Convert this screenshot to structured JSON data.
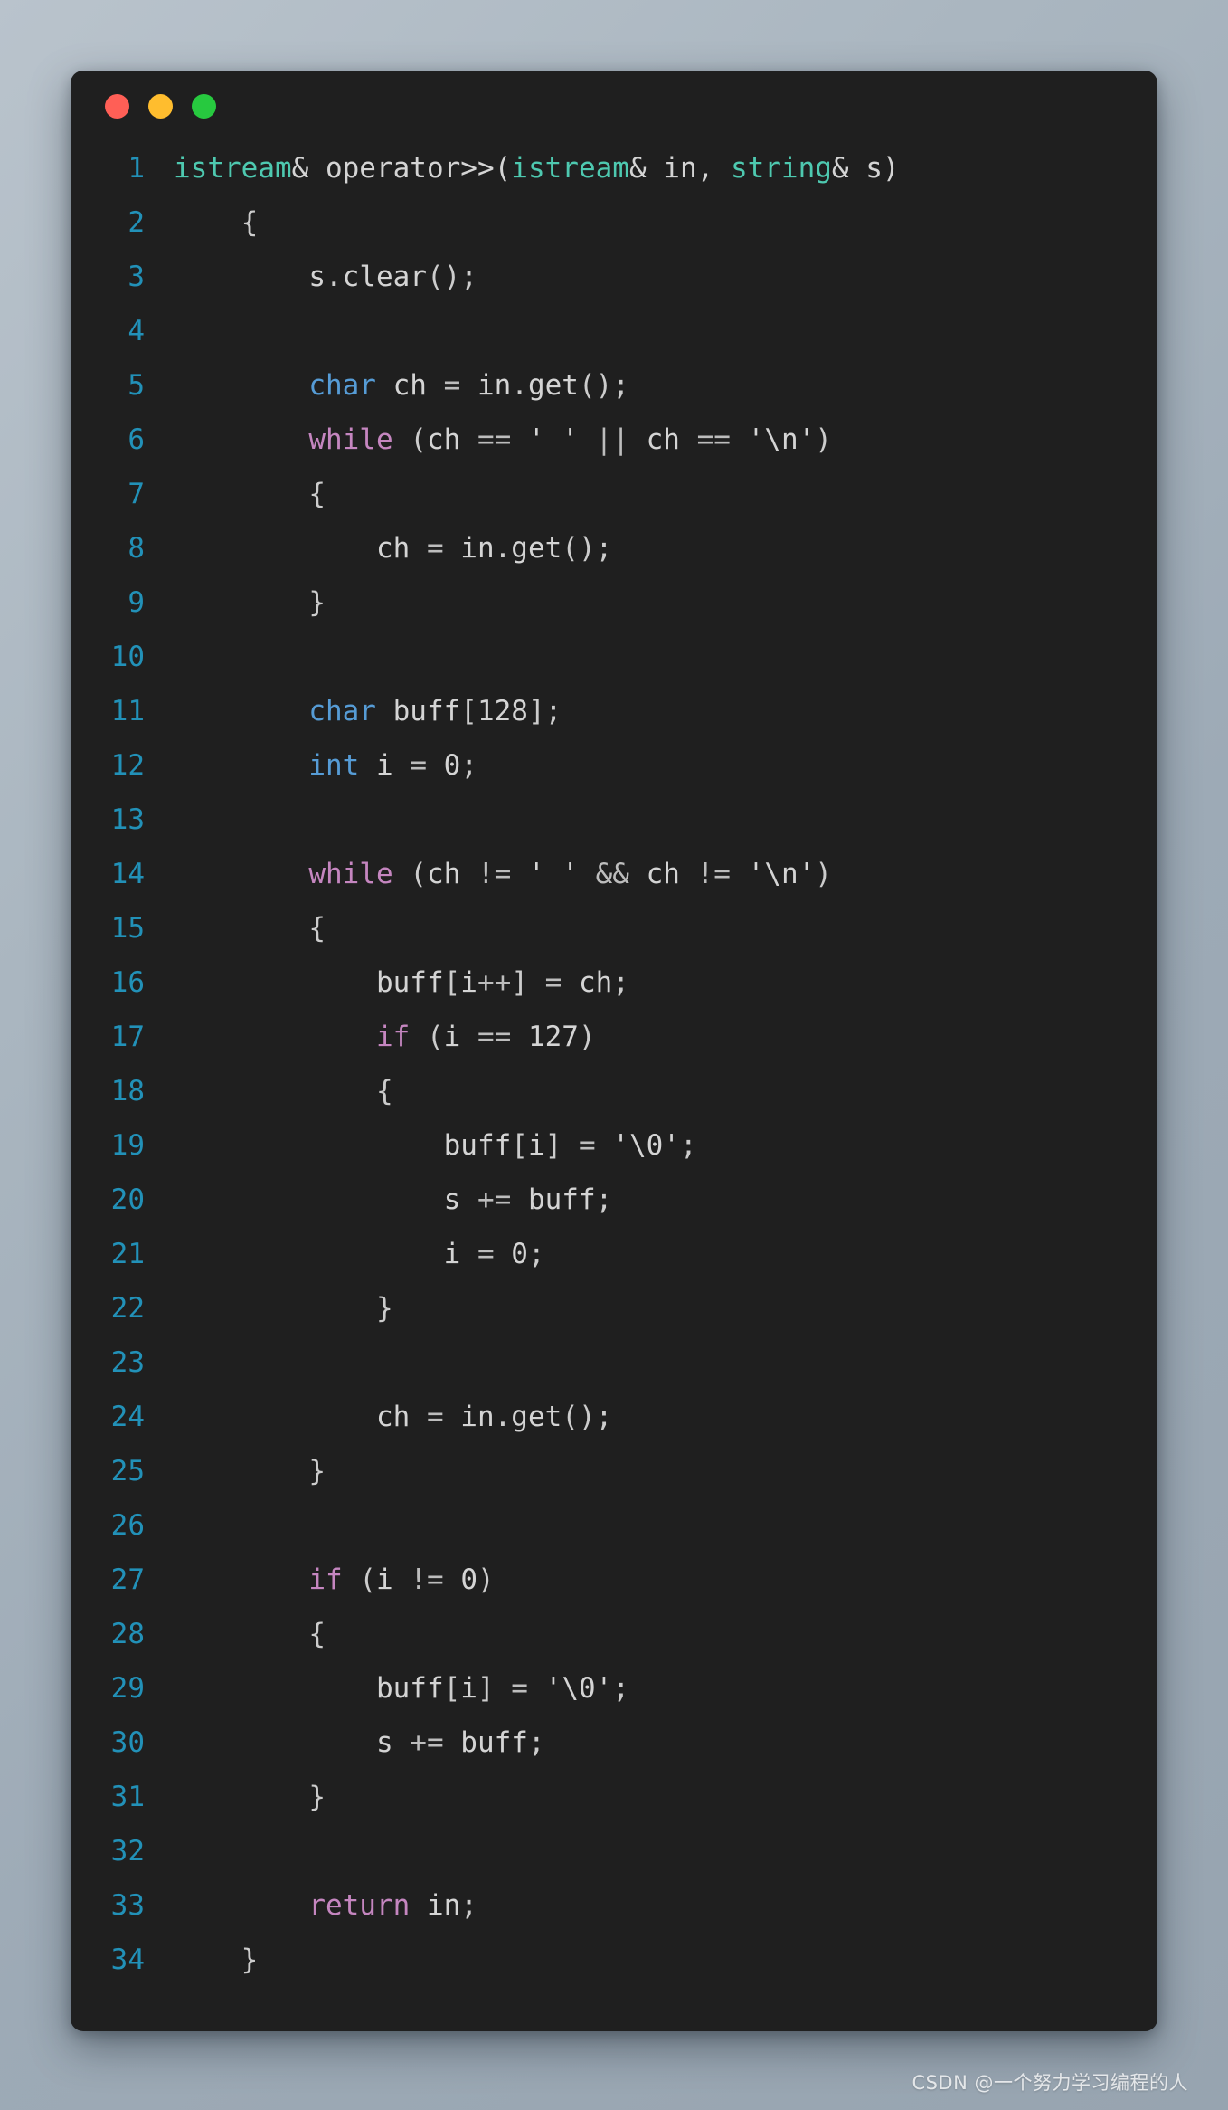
{
  "window": {
    "background_color": "#1f1f1f",
    "page_background_from": "#b9c3cc",
    "page_background_to": "#97a4b0",
    "traffic_lights": [
      {
        "name": "close",
        "color": "#ff5f56"
      },
      {
        "name": "minimize",
        "color": "#ffbd2e"
      },
      {
        "name": "maximize",
        "color": "#27c93f"
      }
    ]
  },
  "theme": {
    "line_number_color": "#2291b8",
    "plain": "#d4d4d4",
    "type": "#4ec9b0",
    "keyword": "#569cd6",
    "control": "#c586c0",
    "function": "#dcdcaa",
    "variable": "#9cdcfe",
    "number": "#b5cea8",
    "string": "#e8b4a0",
    "escape": "#f3c178"
  },
  "watermark": {
    "text": "CSDN @一个努力学习编程的人"
  },
  "code": {
    "language": "cpp",
    "first_line_number": 1,
    "total_lines": 34,
    "lines": [
      {
        "n": "1",
        "text": "istream& operator>>(istream& in, string& s)",
        "tokens": [
          {
            "t": "istream",
            "c": "type"
          },
          {
            "t": "& ",
            "c": "plain"
          },
          {
            "t": "operator",
            "c": "plain"
          },
          {
            "t": ">>",
            "c": "plain"
          },
          {
            "t": "(",
            "c": "plain"
          },
          {
            "t": "istream",
            "c": "type"
          },
          {
            "t": "& ",
            "c": "plain"
          },
          {
            "t": "in",
            "c": "plain"
          },
          {
            "t": ", ",
            "c": "plain"
          },
          {
            "t": "string",
            "c": "type"
          },
          {
            "t": "& ",
            "c": "plain"
          },
          {
            "t": "s",
            "c": "plain"
          },
          {
            "t": ")",
            "c": "plain"
          }
        ]
      },
      {
        "n": "2",
        "text": "    {",
        "tokens": [
          {
            "t": "    ",
            "c": "plain"
          },
          {
            "t": "{",
            "c": "punct"
          }
        ]
      },
      {
        "n": "3",
        "text": "        s.clear();",
        "tokens": [
          {
            "t": "        ",
            "c": "plain"
          },
          {
            "t": "s",
            "c": "plain"
          },
          {
            "t": ".",
            "c": "punct"
          },
          {
            "t": "clear",
            "c": "function"
          },
          {
            "t": "();",
            "c": "punct"
          }
        ]
      },
      {
        "n": "4",
        "text": "",
        "tokens": []
      },
      {
        "n": "5",
        "text": "        char ch = in.get();",
        "tokens": [
          {
            "t": "        ",
            "c": "plain"
          },
          {
            "t": "char",
            "c": "keyword"
          },
          {
            "t": " ",
            "c": "plain"
          },
          {
            "t": "ch",
            "c": "variable"
          },
          {
            "t": " = ",
            "c": "op"
          },
          {
            "t": "in",
            "c": "plain"
          },
          {
            "t": ".",
            "c": "punct"
          },
          {
            "t": "get",
            "c": "function"
          },
          {
            "t": "();",
            "c": "punct"
          }
        ]
      },
      {
        "n": "6",
        "text": "        while (ch == ' ' || ch == '\\n')",
        "tokens": [
          {
            "t": "        ",
            "c": "plain"
          },
          {
            "t": "while",
            "c": "control"
          },
          {
            "t": " ",
            "c": "plain"
          },
          {
            "t": "(",
            "c": "punct"
          },
          {
            "t": "ch",
            "c": "variable"
          },
          {
            "t": " == ",
            "c": "op"
          },
          {
            "t": "' '",
            "c": "string"
          },
          {
            "t": " ",
            "c": "plain"
          },
          {
            "t": "||",
            "c": "op"
          },
          {
            "t": " ",
            "c": "plain"
          },
          {
            "t": "ch",
            "c": "variable"
          },
          {
            "t": " == ",
            "c": "op"
          },
          {
            "t": "'",
            "c": "string"
          },
          {
            "t": "\\n",
            "c": "escape"
          },
          {
            "t": "'",
            "c": "string"
          },
          {
            "t": ")",
            "c": "punct"
          }
        ]
      },
      {
        "n": "7",
        "text": "        {",
        "tokens": [
          {
            "t": "        ",
            "c": "plain"
          },
          {
            "t": "{",
            "c": "punct"
          }
        ]
      },
      {
        "n": "8",
        "text": "            ch = in.get();",
        "tokens": [
          {
            "t": "            ",
            "c": "plain"
          },
          {
            "t": "ch",
            "c": "variable"
          },
          {
            "t": " = ",
            "c": "op"
          },
          {
            "t": "in",
            "c": "plain"
          },
          {
            "t": ".",
            "c": "punct"
          },
          {
            "t": "get",
            "c": "function"
          },
          {
            "t": "();",
            "c": "punct"
          }
        ]
      },
      {
        "n": "9",
        "text": "        }",
        "tokens": [
          {
            "t": "        ",
            "c": "plain"
          },
          {
            "t": "}",
            "c": "punct"
          }
        ]
      },
      {
        "n": "10",
        "text": "",
        "tokens": []
      },
      {
        "n": "11",
        "text": "        char buff[128];",
        "tokens": [
          {
            "t": "        ",
            "c": "plain"
          },
          {
            "t": "char",
            "c": "keyword"
          },
          {
            "t": " ",
            "c": "plain"
          },
          {
            "t": "buff",
            "c": "variable"
          },
          {
            "t": "[",
            "c": "punct"
          },
          {
            "t": "128",
            "c": "number"
          },
          {
            "t": "];",
            "c": "punct"
          }
        ]
      },
      {
        "n": "12",
        "text": "        int i = 0;",
        "tokens": [
          {
            "t": "        ",
            "c": "plain"
          },
          {
            "t": "int",
            "c": "keyword"
          },
          {
            "t": " ",
            "c": "plain"
          },
          {
            "t": "i",
            "c": "variable"
          },
          {
            "t": " = ",
            "c": "op"
          },
          {
            "t": "0",
            "c": "number"
          },
          {
            "t": ";",
            "c": "punct"
          }
        ]
      },
      {
        "n": "13",
        "text": "",
        "tokens": []
      },
      {
        "n": "14",
        "text": "        while (ch != ' ' && ch != '\\n')",
        "tokens": [
          {
            "t": "        ",
            "c": "plain"
          },
          {
            "t": "while",
            "c": "control"
          },
          {
            "t": " ",
            "c": "plain"
          },
          {
            "t": "(",
            "c": "punct"
          },
          {
            "t": "ch",
            "c": "variable"
          },
          {
            "t": " != ",
            "c": "op"
          },
          {
            "t": "' '",
            "c": "string"
          },
          {
            "t": " ",
            "c": "plain"
          },
          {
            "t": "&&",
            "c": "op"
          },
          {
            "t": " ",
            "c": "plain"
          },
          {
            "t": "ch",
            "c": "variable"
          },
          {
            "t": " != ",
            "c": "op"
          },
          {
            "t": "'",
            "c": "string"
          },
          {
            "t": "\\n",
            "c": "escape"
          },
          {
            "t": "'",
            "c": "string"
          },
          {
            "t": ")",
            "c": "punct"
          }
        ]
      },
      {
        "n": "15",
        "text": "        {",
        "tokens": [
          {
            "t": "        ",
            "c": "plain"
          },
          {
            "t": "{",
            "c": "punct"
          }
        ]
      },
      {
        "n": "16",
        "text": "            buff[i++] = ch;",
        "tokens": [
          {
            "t": "            ",
            "c": "plain"
          },
          {
            "t": "buff",
            "c": "variable"
          },
          {
            "t": "[",
            "c": "punct"
          },
          {
            "t": "i",
            "c": "variable"
          },
          {
            "t": "++",
            "c": "op"
          },
          {
            "t": "]",
            "c": "punct"
          },
          {
            "t": " = ",
            "c": "op"
          },
          {
            "t": "ch",
            "c": "variable"
          },
          {
            "t": ";",
            "c": "punct"
          }
        ]
      },
      {
        "n": "17",
        "text": "            if (i == 127)",
        "tokens": [
          {
            "t": "            ",
            "c": "plain"
          },
          {
            "t": "if",
            "c": "control"
          },
          {
            "t": " ",
            "c": "plain"
          },
          {
            "t": "(",
            "c": "punct"
          },
          {
            "t": "i",
            "c": "variable"
          },
          {
            "t": " == ",
            "c": "op"
          },
          {
            "t": "127",
            "c": "number"
          },
          {
            "t": ")",
            "c": "punct"
          }
        ]
      },
      {
        "n": "18",
        "text": "            {",
        "tokens": [
          {
            "t": "            ",
            "c": "plain"
          },
          {
            "t": "{",
            "c": "punct"
          }
        ]
      },
      {
        "n": "19",
        "text": "                buff[i] = '\\0';",
        "tokens": [
          {
            "t": "                ",
            "c": "plain"
          },
          {
            "t": "buff",
            "c": "variable"
          },
          {
            "t": "[",
            "c": "punct"
          },
          {
            "t": "i",
            "c": "variable"
          },
          {
            "t": "]",
            "c": "punct"
          },
          {
            "t": " = ",
            "c": "op"
          },
          {
            "t": "'",
            "c": "string"
          },
          {
            "t": "\\0",
            "c": "escape"
          },
          {
            "t": "'",
            "c": "string"
          },
          {
            "t": ";",
            "c": "punct"
          }
        ]
      },
      {
        "n": "20",
        "text": "                s += buff;",
        "tokens": [
          {
            "t": "                ",
            "c": "plain"
          },
          {
            "t": "s",
            "c": "plain"
          },
          {
            "t": " += ",
            "c": "op"
          },
          {
            "t": "buff",
            "c": "variable"
          },
          {
            "t": ";",
            "c": "punct"
          }
        ]
      },
      {
        "n": "21",
        "text": "                i = 0;",
        "tokens": [
          {
            "t": "                ",
            "c": "plain"
          },
          {
            "t": "i",
            "c": "variable"
          },
          {
            "t": " = ",
            "c": "op"
          },
          {
            "t": "0",
            "c": "number"
          },
          {
            "t": ";",
            "c": "punct"
          }
        ]
      },
      {
        "n": "22",
        "text": "            }",
        "tokens": [
          {
            "t": "            ",
            "c": "plain"
          },
          {
            "t": "}",
            "c": "punct"
          }
        ]
      },
      {
        "n": "23",
        "text": "",
        "tokens": []
      },
      {
        "n": "24",
        "text": "            ch = in.get();",
        "tokens": [
          {
            "t": "            ",
            "c": "plain"
          },
          {
            "t": "ch",
            "c": "variable"
          },
          {
            "t": " = ",
            "c": "op"
          },
          {
            "t": "in",
            "c": "plain"
          },
          {
            "t": ".",
            "c": "punct"
          },
          {
            "t": "get",
            "c": "function"
          },
          {
            "t": "();",
            "c": "punct"
          }
        ]
      },
      {
        "n": "25",
        "text": "        }",
        "tokens": [
          {
            "t": "        ",
            "c": "plain"
          },
          {
            "t": "}",
            "c": "punct"
          }
        ]
      },
      {
        "n": "26",
        "text": "",
        "tokens": []
      },
      {
        "n": "27",
        "text": "        if (i != 0)",
        "tokens": [
          {
            "t": "        ",
            "c": "plain"
          },
          {
            "t": "if",
            "c": "control"
          },
          {
            "t": " ",
            "c": "plain"
          },
          {
            "t": "(",
            "c": "punct"
          },
          {
            "t": "i",
            "c": "variable"
          },
          {
            "t": " != ",
            "c": "op"
          },
          {
            "t": "0",
            "c": "number"
          },
          {
            "t": ")",
            "c": "punct"
          }
        ]
      },
      {
        "n": "28",
        "text": "        {",
        "tokens": [
          {
            "t": "        ",
            "c": "plain"
          },
          {
            "t": "{",
            "c": "punct"
          }
        ]
      },
      {
        "n": "29",
        "text": "            buff[i] = '\\0';",
        "tokens": [
          {
            "t": "            ",
            "c": "plain"
          },
          {
            "t": "buff",
            "c": "variable"
          },
          {
            "t": "[",
            "c": "punct"
          },
          {
            "t": "i",
            "c": "variable"
          },
          {
            "t": "]",
            "c": "punct"
          },
          {
            "t": " = ",
            "c": "op"
          },
          {
            "t": "'",
            "c": "string"
          },
          {
            "t": "\\0",
            "c": "escape"
          },
          {
            "t": "'",
            "c": "string"
          },
          {
            "t": ";",
            "c": "punct"
          }
        ]
      },
      {
        "n": "30",
        "text": "            s += buff;",
        "tokens": [
          {
            "t": "            ",
            "c": "plain"
          },
          {
            "t": "s",
            "c": "plain"
          },
          {
            "t": " += ",
            "c": "op"
          },
          {
            "t": "buff",
            "c": "variable"
          },
          {
            "t": ";",
            "c": "punct"
          }
        ]
      },
      {
        "n": "31",
        "text": "        }",
        "tokens": [
          {
            "t": "        ",
            "c": "plain"
          },
          {
            "t": "}",
            "c": "punct"
          }
        ]
      },
      {
        "n": "32",
        "text": "",
        "tokens": []
      },
      {
        "n": "33",
        "text": "        return in;",
        "tokens": [
          {
            "t": "        ",
            "c": "plain"
          },
          {
            "t": "return",
            "c": "control"
          },
          {
            "t": " ",
            "c": "plain"
          },
          {
            "t": "in",
            "c": "plain"
          },
          {
            "t": ";",
            "c": "punct"
          }
        ]
      },
      {
        "n": "34",
        "text": "    }",
        "tokens": [
          {
            "t": "    ",
            "c": "plain"
          },
          {
            "t": "}",
            "c": "punct"
          }
        ]
      }
    ]
  }
}
